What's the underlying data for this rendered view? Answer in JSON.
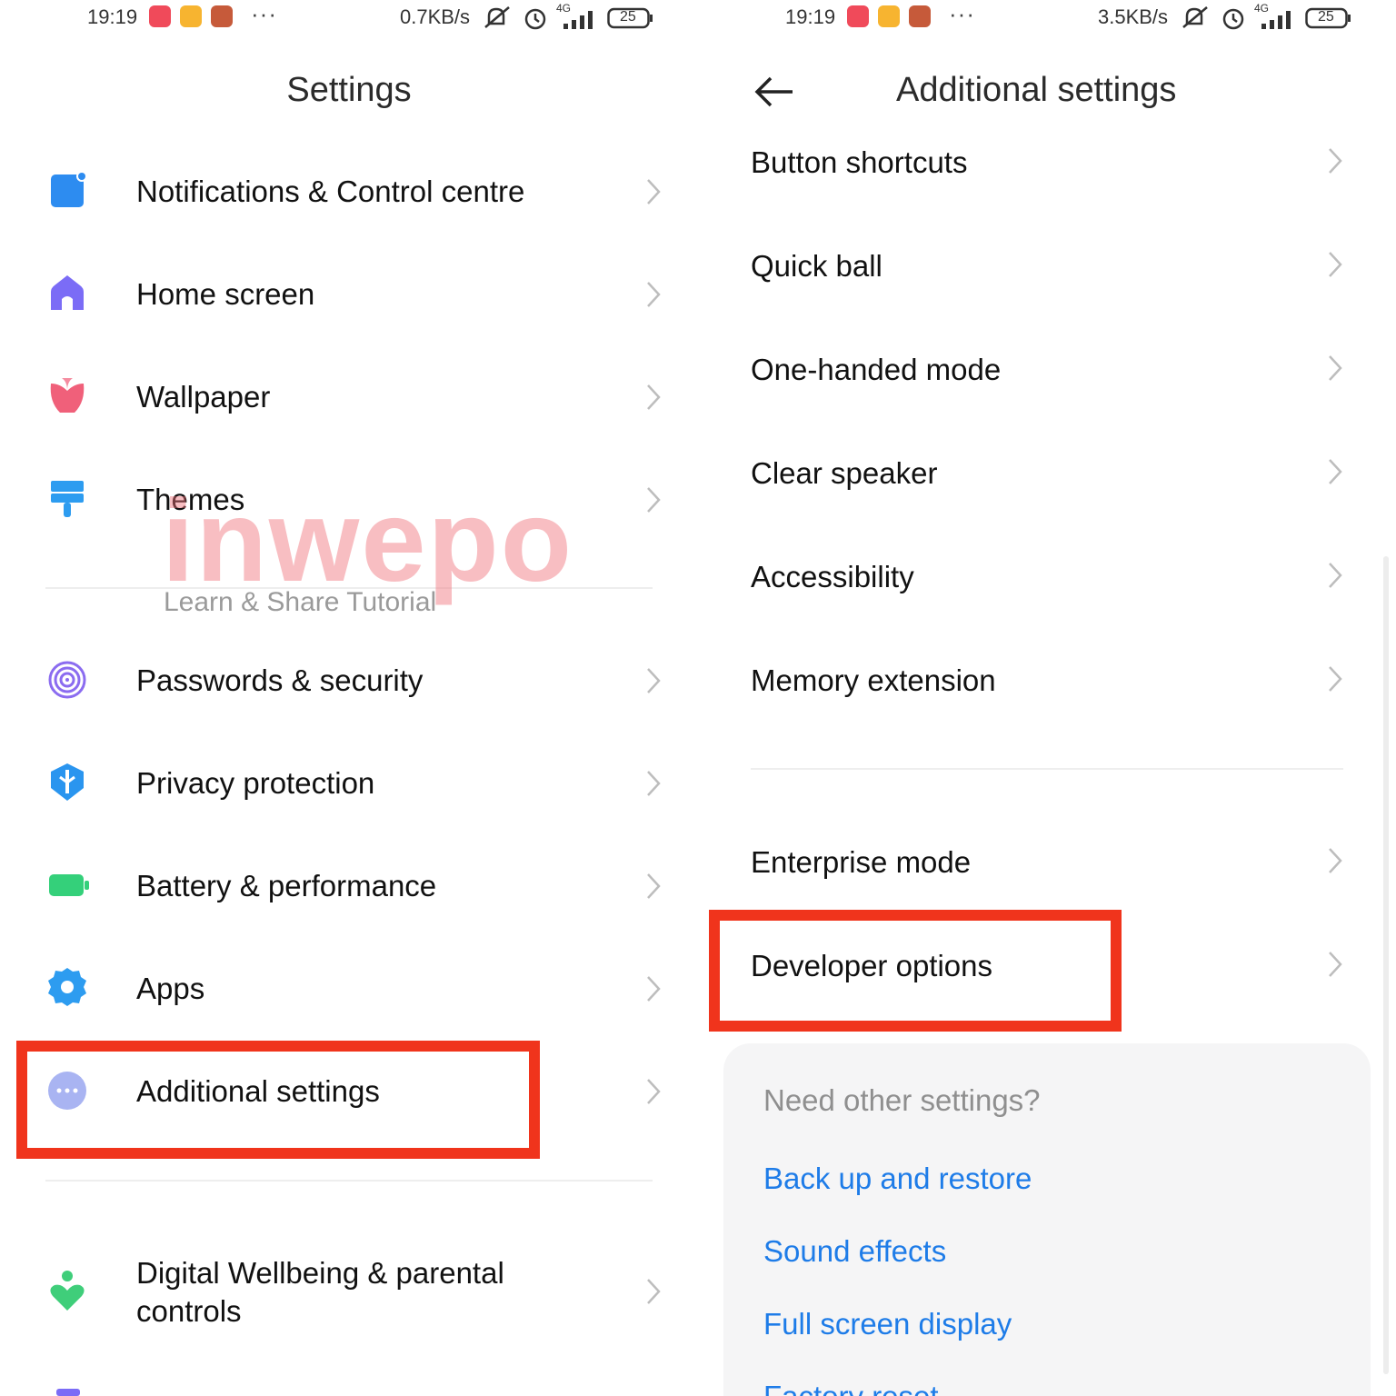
{
  "left": {
    "status": {
      "time": "19:19",
      "dots": "···",
      "speed": "0.7KB/s",
      "network": "4G",
      "battery": "25"
    },
    "title": "Settings",
    "items": [
      {
        "label": "Notifications & Control centre",
        "icon": "notification-icon"
      },
      {
        "label": "Home screen",
        "icon": "home-icon"
      },
      {
        "label": "Wallpaper",
        "icon": "flower-icon"
      },
      {
        "label": "Themes",
        "icon": "paintbrush-icon"
      },
      {
        "label": "Passwords & security",
        "icon": "fingerprint-icon"
      },
      {
        "label": "Privacy protection",
        "icon": "shield-icon"
      },
      {
        "label": "Battery & performance",
        "icon": "battery-icon"
      },
      {
        "label": "Apps",
        "icon": "gear-icon"
      },
      {
        "label": "Additional settings",
        "icon": "more-icon"
      },
      {
        "label": "Digital Wellbeing & parental controls",
        "label_line1": "Digital Wellbeing & parental",
        "label_line2": "controls",
        "icon": "wellbeing-icon"
      }
    ]
  },
  "watermark": {
    "brand": "inwepo",
    "tagline": "Learn & Share Tutorial"
  },
  "right": {
    "status": {
      "time": "19:19",
      "dots": "···",
      "speed": "3.5KB/s",
      "network": "4G",
      "battery": "25"
    },
    "title": "Additional settings",
    "items": [
      {
        "label": "Button shortcuts"
      },
      {
        "label": "Quick ball"
      },
      {
        "label": "One-handed mode"
      },
      {
        "label": "Clear speaker"
      },
      {
        "label": "Accessibility"
      },
      {
        "label": "Memory extension"
      },
      {
        "label": "Enterprise mode"
      },
      {
        "label": "Developer options"
      }
    ],
    "card": {
      "title": "Need other settings?",
      "links": [
        "Back up and restore",
        "Sound effects",
        "Full screen display",
        "Factory reset"
      ]
    }
  },
  "colors": {
    "highlight": "#f0341c",
    "link": "#1e7ce8",
    "notification_icon": "#2d8cf0",
    "home_icon": "#7b6cf6",
    "wallpaper_icon": "#f0607a",
    "themes_icon": "#2d9cf0",
    "security_icon": "#8b6cf0",
    "privacy_icon": "#2a95ef",
    "battery_icon": "#34d07a",
    "apps_icon": "#2d9cf0",
    "more_icon": "#a9b4f2",
    "wellbeing_icon": "#3fce7a"
  }
}
